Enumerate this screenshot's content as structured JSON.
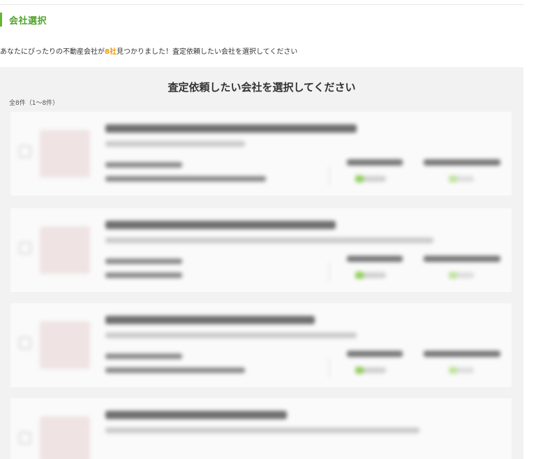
{
  "section": {
    "title": "会社選択"
  },
  "result": {
    "prefix": "あなたにぴったりの不動産会社が",
    "count": "8社",
    "suffix": "見つかりました！査定依頼したい会社を選択してください"
  },
  "list": {
    "heading": "査定依頼したい会社を選択してください",
    "total": "全8件（1〜8件）"
  },
  "colors": {
    "accent": "#63b72e",
    "accent_text": "#4fa22a",
    "count_highlight": "#f39800",
    "panel_bg": "#f2f2f2"
  },
  "icons": {
    "checkbox": "checkbox-icon",
    "stat_check": "check-icon"
  }
}
